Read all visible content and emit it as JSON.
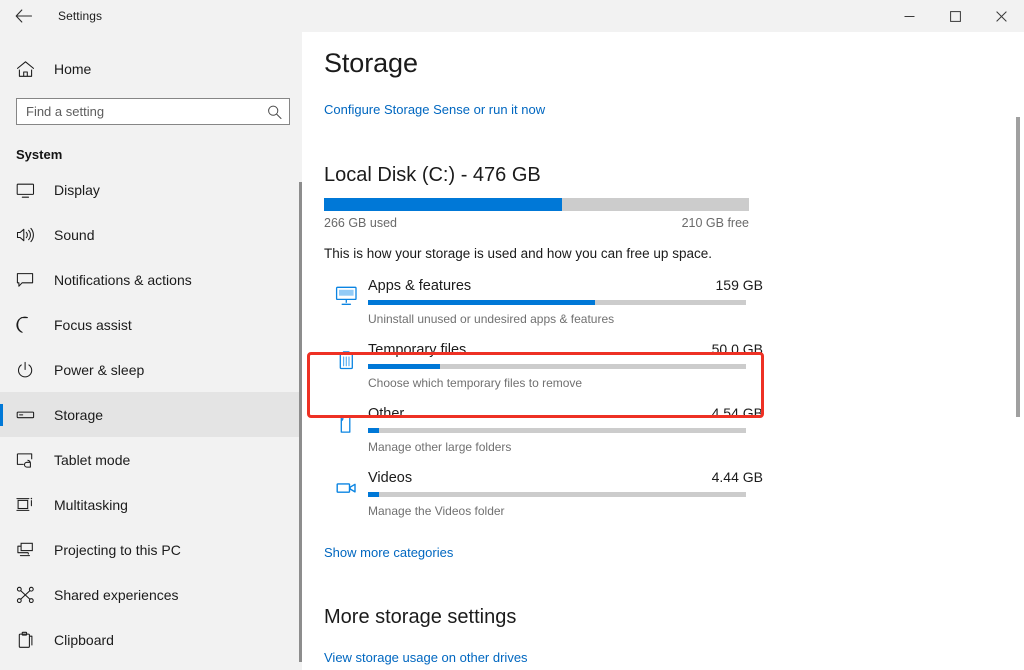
{
  "titlebar": {
    "back_icon": "back-arrow-icon",
    "app_title": "Settings",
    "minimize_label": "minimize-icon",
    "maximize_label": "maximize-icon",
    "close_label": "close-icon"
  },
  "sidebar": {
    "home": {
      "label": "Home",
      "icon": "home-icon"
    },
    "search": {
      "placeholder": "Find a setting",
      "value": "",
      "icon": "search-icon"
    },
    "group_header": "System",
    "items": [
      {
        "label": "Display",
        "icon": "monitor-icon",
        "selected": false
      },
      {
        "label": "Sound",
        "icon": "speaker-icon",
        "selected": false
      },
      {
        "label": "Notifications & actions",
        "icon": "notification-icon",
        "selected": false
      },
      {
        "label": "Focus assist",
        "icon": "moon-icon",
        "selected": false
      },
      {
        "label": "Power & sleep",
        "icon": "power-icon",
        "selected": false
      },
      {
        "label": "Storage",
        "icon": "drive-icon",
        "selected": true
      },
      {
        "label": "Tablet mode",
        "icon": "tablet-icon",
        "selected": false
      },
      {
        "label": "Multitasking",
        "icon": "multitasking-icon",
        "selected": false
      },
      {
        "label": "Projecting to this PC",
        "icon": "project-icon",
        "selected": false
      },
      {
        "label": "Shared experiences",
        "icon": "share-icon",
        "selected": false
      },
      {
        "label": "Clipboard",
        "icon": "clipboard-icon",
        "selected": false
      }
    ]
  },
  "main": {
    "page_title": "Storage",
    "storage_sense_link": "Configure Storage Sense or run it now",
    "disk": {
      "title": "Local Disk (C:) - 476 GB",
      "used_label": "266 GB used",
      "free_label": "210 GB free",
      "used_percent": 56
    },
    "description": "This is how your storage is used and how you can free up space.",
    "categories": [
      {
        "name": "Apps & features",
        "size": "159 GB",
        "subtitle": "Uninstall unused or undesired apps & features",
        "percent": 60,
        "icon": "apps-features-icon",
        "highlighted": false
      },
      {
        "name": "Temporary files",
        "size": "50.0 GB",
        "subtitle": "Choose which temporary files to remove",
        "percent": 19,
        "icon": "trash-icon",
        "highlighted": true
      },
      {
        "name": "Other",
        "size": "4.54 GB",
        "subtitle": "Manage other large folders",
        "percent": 3,
        "icon": "folder-icon",
        "highlighted": false
      },
      {
        "name": "Videos",
        "size": "4.44 GB",
        "subtitle": "Manage the Videos folder",
        "percent": 3,
        "icon": "video-camera-icon",
        "highlighted": false
      }
    ],
    "show_more_link": "Show more categories",
    "more_settings_title": "More storage settings",
    "other_drives_link": "View storage usage on other drives"
  },
  "colors": {
    "accent": "#0078d7",
    "link": "#0067c0",
    "highlight": "#ee3124",
    "sidebar_bg": "#f2f2f2",
    "track": "#cccccc"
  }
}
